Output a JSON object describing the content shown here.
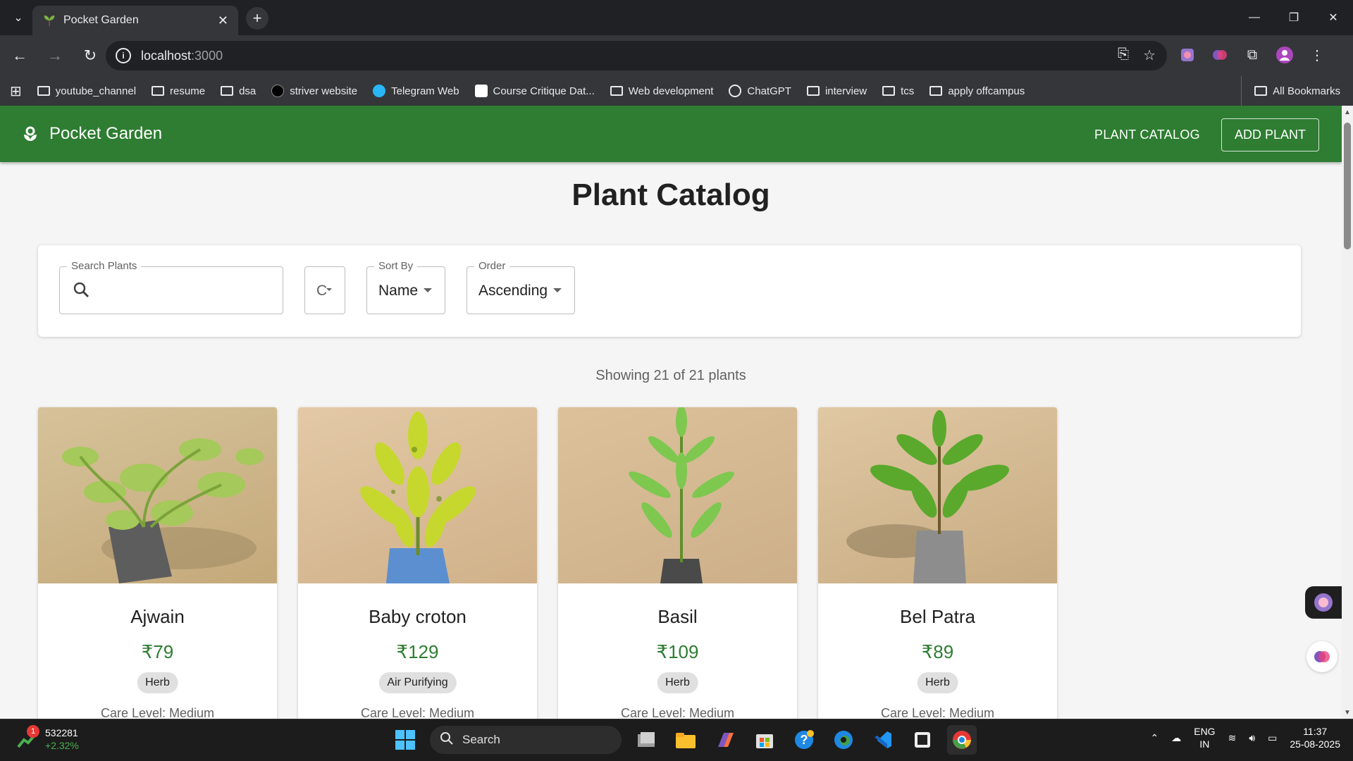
{
  "browser": {
    "tab_title": "Pocket Garden",
    "url_host": "localhost",
    "url_port": ":3000",
    "bookmarks": [
      "youtube_channel",
      "resume",
      "dsa",
      "striver website",
      "Telegram Web",
      "Course Critique Dat...",
      "Web development",
      "ChatGPT",
      "interview",
      "tcs",
      "apply offcampus"
    ],
    "all_bookmarks": "All Bookmarks"
  },
  "app": {
    "brand": "Pocket Garden",
    "nav_catalog": "PLANT CATALOG",
    "nav_add": "ADD PLANT",
    "heading": "Plant Catalog",
    "filters": {
      "search_label": "Search Plants",
      "category_value": "C",
      "sort_label": "Sort By",
      "sort_value": "Name",
      "order_label": "Order",
      "order_value": "Ascending"
    },
    "count_text": "Showing 21 of 21 plants",
    "plants": [
      {
        "name": "Ajwain",
        "price": "₹79",
        "tag": "Herb",
        "care": "Care Level: Medium"
      },
      {
        "name": "Baby croton",
        "price": "₹129",
        "tag": "Air Purifying",
        "care": "Care Level: Medium"
      },
      {
        "name": "Basil",
        "price": "₹109",
        "tag": "Herb",
        "care": "Care Level: Medium"
      },
      {
        "name": "Bel Patra",
        "price": "₹89",
        "tag": "Herb",
        "care": "Care Level: Medium"
      }
    ],
    "colors": {
      "primary": "#2e7d32",
      "background": "#f5f5f5"
    }
  },
  "taskbar": {
    "stock_value": "532281",
    "stock_change": "+2.32%",
    "notification_count": "1",
    "search_label": "Search",
    "lang_top": "ENG",
    "lang_bottom": "IN",
    "time": "11:37",
    "date": "25-08-2025"
  }
}
